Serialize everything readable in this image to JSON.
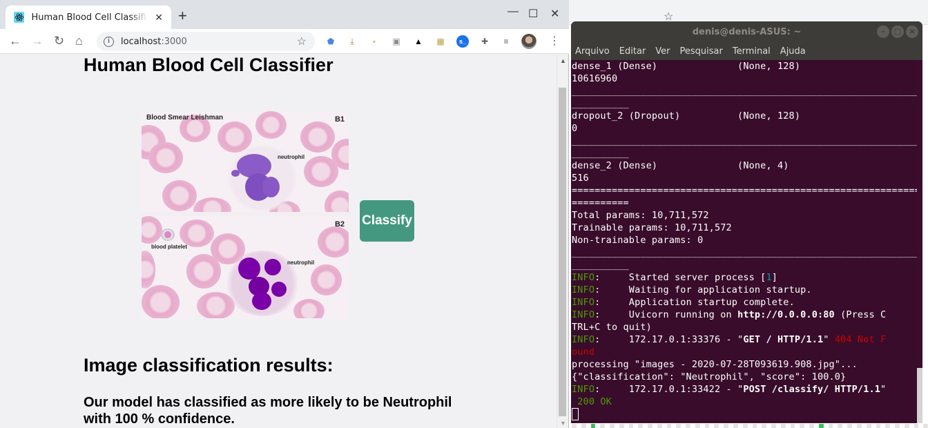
{
  "browser": {
    "tab_title": "Human Blood Cell Classifier",
    "url_host": "localhost",
    "url_port": ":3000",
    "new_tab": "+",
    "close_tab": "✕",
    "minimize": "—",
    "maximize": "☐",
    "close_window": "✕",
    "back": "←",
    "forward": "→",
    "reload": "↻",
    "home": "⌂",
    "star": "☆",
    "menu": "⋮",
    "extensions": [
      {
        "name": "blue-shield-extension-icon",
        "glyph": "⬟",
        "color": "#4a86e8"
      },
      {
        "name": "download-extension-icon",
        "glyph": "⤓",
        "color": "#c8702a"
      },
      {
        "name": "box-face-extension-icon",
        "glyph": "▪",
        "color": "#e0b48a"
      },
      {
        "name": "screenshot-extension-icon",
        "glyph": "▣",
        "color": "#8a8a8a"
      },
      {
        "name": "crow-extension-icon",
        "glyph": "▲",
        "color": "#111111"
      },
      {
        "name": "image-extension-icon",
        "glyph": "▦",
        "color": "#b7a24b"
      },
      {
        "name": "terminal-extension-icon",
        "glyph": "s_",
        "color": "#1a73e8"
      },
      {
        "name": "puzzle-extension-icon",
        "glyph": "✚",
        "color": "#5f6368"
      },
      {
        "name": "media-queue-icon",
        "glyph": "≡",
        "color": "#5f6368"
      }
    ]
  },
  "page": {
    "title": "Human Blood Cell Classifier",
    "image": {
      "panel1_label": "Blood Smear   Leishman",
      "panel1_corner": "B1",
      "panel1_cell_label": "neutrophil",
      "panel2_corner": "B2",
      "panel2_platelet_label": "blood platelet",
      "panel2_cell_label": "neutrophil"
    },
    "classify_button": "Classify",
    "results_heading": "Image classification results:",
    "result_text": "Our model has classified as more likely to be Neutrophil with 100 % confidence.",
    "classification": "Neutrophil",
    "confidence_percent": 100,
    "accent_color": "#459880"
  },
  "terminal": {
    "title": "denis@denis-ASUS: ~",
    "menu": [
      "Arquivo",
      "Editar",
      "Ver",
      "Pesquisar",
      "Terminal",
      "Ajuda"
    ],
    "lines": {
      "l1": "dense_1 (Dense)              (None, 128)",
      "l2": "10616960",
      "l3": "_________________________________________________________________",
      "l4": "__________",
      "l5": "dropout_2 (Dropout)          (None, 128)",
      "l6": "0",
      "l7": "_________________________________________________________________",
      "l8": "__________",
      "l9": "dense_2 (Dense)              (None, 4)",
      "l10": "516",
      "l11": "=================================================================",
      "l12": "==========",
      "l13": "Total params: 10,711,572",
      "l14": "Trainable params: 10,711,572",
      "l15": "Non-trainable params: 0",
      "l16": "_________________________________________________________________",
      "l17": "__________",
      "info_label": "INFO",
      "l18_text": "     Started server process [",
      "l18_pid": "1",
      "l18_end": "]",
      "l19": "     Waiting for application startup.",
      "l20": "     Application startup complete.",
      "l21a": "     Uvicorn running on ",
      "l21b": "http://0.0.0.0:80",
      "l21c": " (Press C",
      "l22": "TRL+C to quit)",
      "l23a": "     172.17.0.1:33376 - \"",
      "l23b": "GET / HTTP/1.1",
      "l23c": "\" ",
      "l23d": "404 Not F",
      "l24": "ound",
      "l25": "processing \"images - 2020-07-28T093619.908.jpg\"...",
      "l26": "{\"classification\": \"Neutrophil\", \"score\": 100.0}",
      "l27a": "     172.17.0.1:33422 - \"",
      "l27b": "POST /classify/ HTTP/1.1",
      "l27c": "\"",
      "l28": " 200 OK"
    }
  }
}
